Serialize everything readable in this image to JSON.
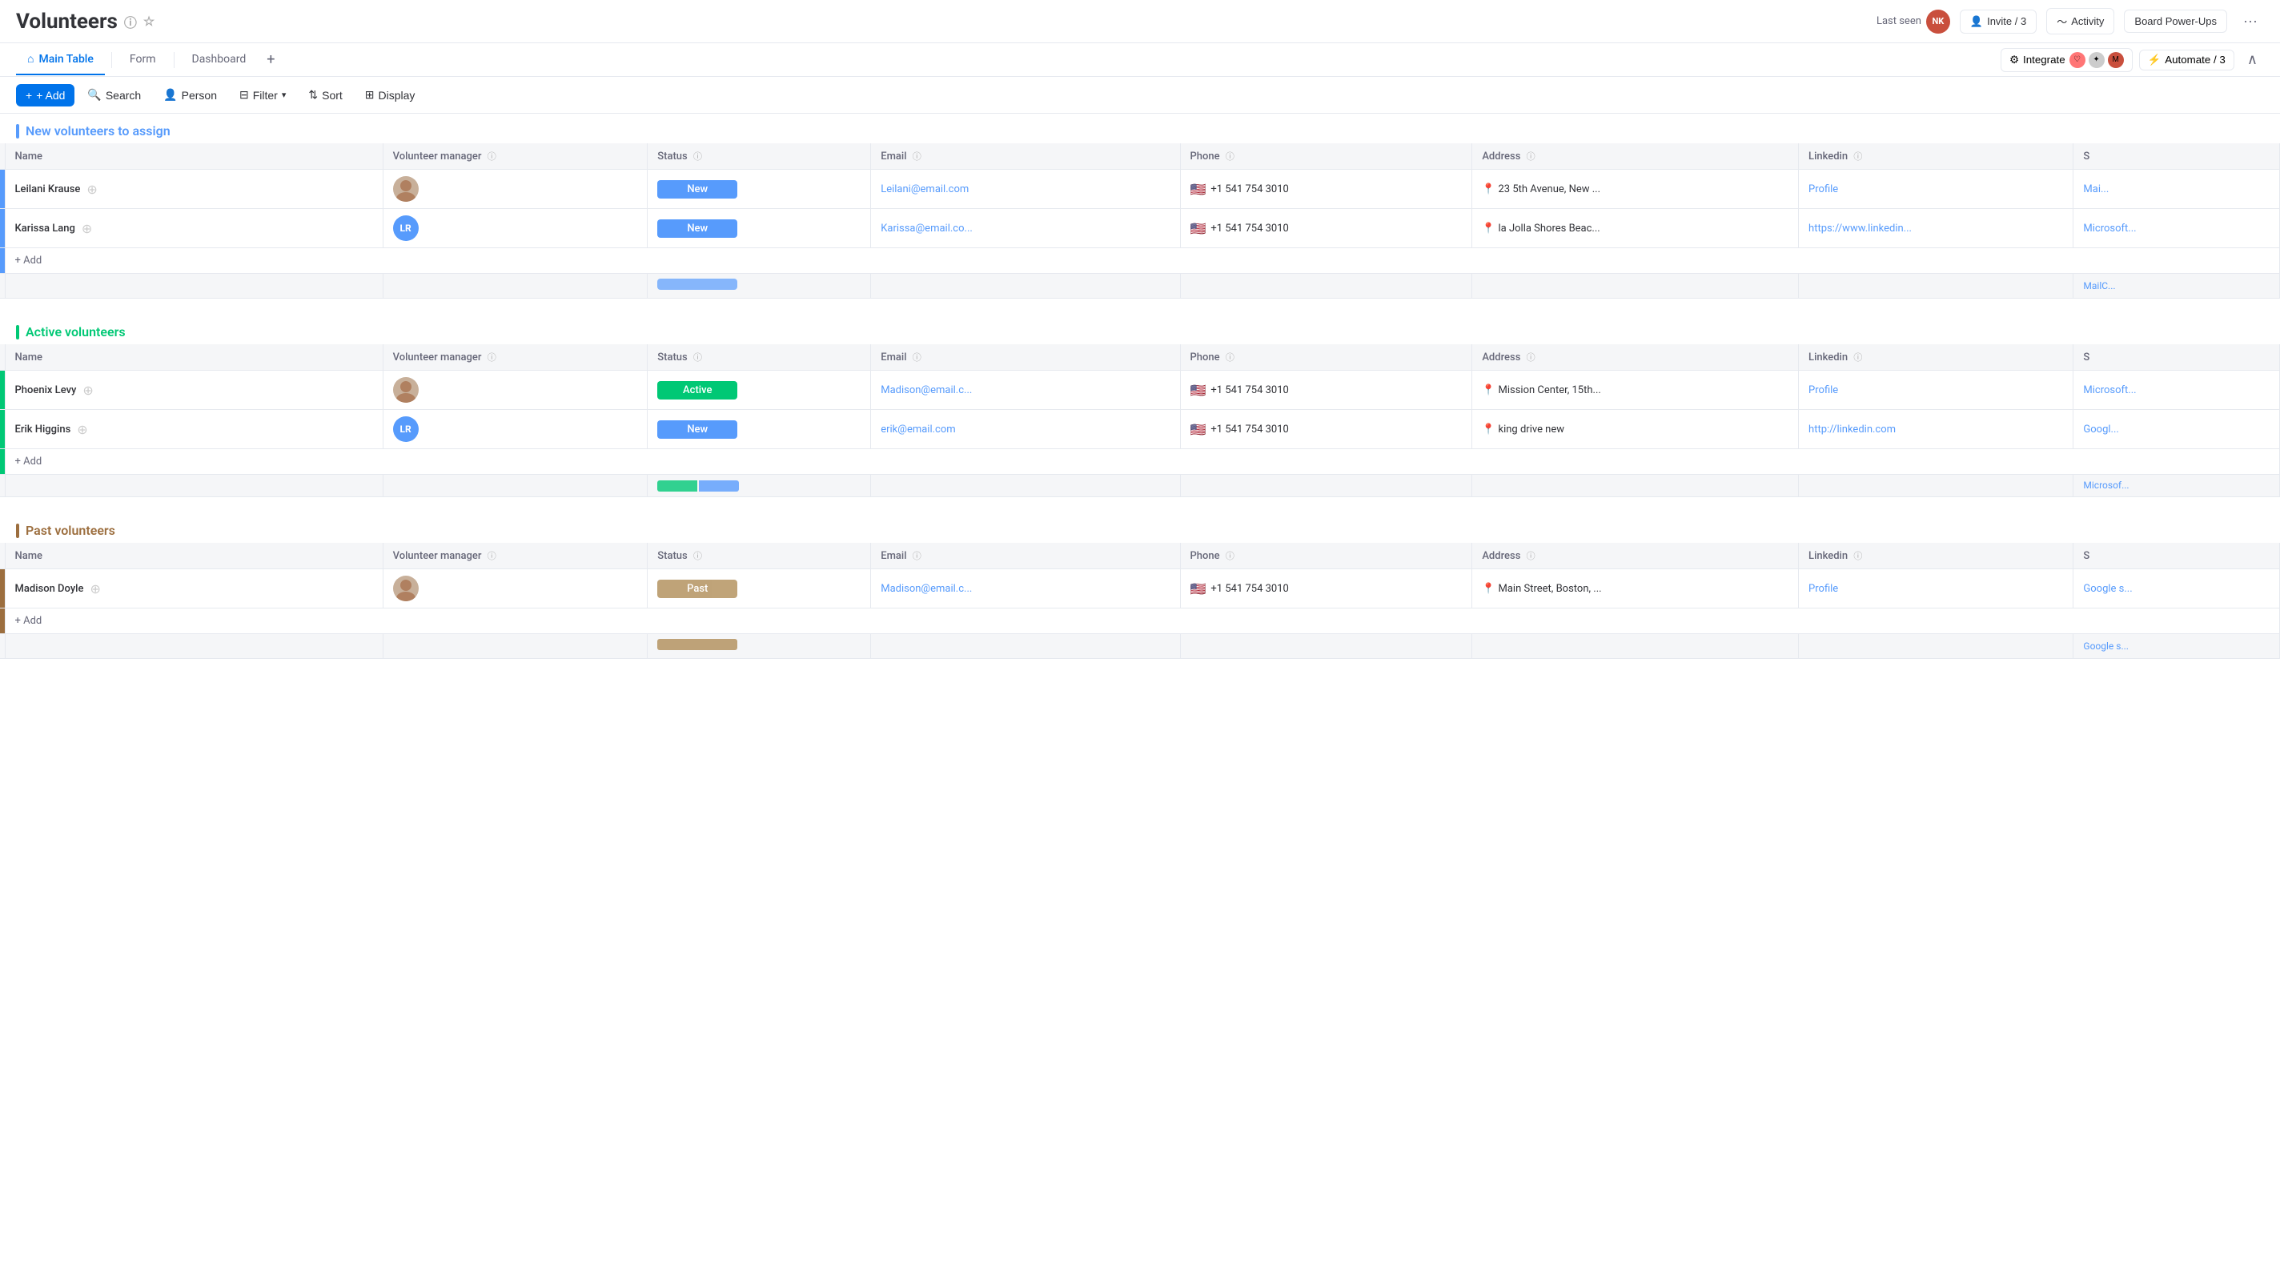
{
  "app": {
    "title": "Volunteers",
    "last_seen_label": "Last seen",
    "invite_label": "Invite / 3",
    "activity_label": "Activity",
    "board_powerups_label": "Board Power-Ups",
    "integrate_label": "Integrate",
    "automate_label": "Automate / 3"
  },
  "tabs": [
    {
      "id": "main-table",
      "label": "Main Table",
      "icon": "⌂",
      "active": true
    },
    {
      "id": "form",
      "label": "Form",
      "icon": "",
      "active": false
    },
    {
      "id": "dashboard",
      "label": "Dashboard",
      "icon": "",
      "active": false
    }
  ],
  "toolbar": {
    "add_label": "+ Add",
    "search_label": "Search",
    "person_label": "Person",
    "filter_label": "Filter",
    "sort_label": "Sort",
    "display_label": "Display"
  },
  "columns": {
    "name": "Name",
    "volunteer_manager": "Volunteer manager",
    "status": "Status",
    "email": "Email",
    "phone": "Phone",
    "address": "Address",
    "linkedin": "Linkedin",
    "s": "S"
  },
  "groups": [
    {
      "id": "new-volunteers",
      "title": "New volunteers to assign",
      "color": "blue",
      "rows": [
        {
          "name": "Leilani Krause",
          "manager_type": "photo",
          "manager_initials": "",
          "status": "New",
          "status_class": "status-new",
          "email": "Leilani@email.com",
          "phone": "+1 541 754 3010",
          "address": "23 5th Avenue, New ...",
          "linkedin": "Profile",
          "s": "Mai..."
        },
        {
          "name": "Karissa Lang",
          "manager_type": "initials",
          "manager_initials": "LR",
          "status": "New",
          "status_class": "status-new",
          "email": "Karissa@email.co...",
          "phone": "+1 541 754 3010",
          "address": "la Jolla Shores Beac...",
          "linkedin": "https://www.linkedin...",
          "s": "Microsoft..."
        }
      ],
      "summary_status_class": "status-new",
      "summary_s": "MailC..."
    },
    {
      "id": "active-volunteers",
      "title": "Active volunteers",
      "color": "green",
      "rows": [
        {
          "name": "Phoenix Levy",
          "manager_type": "photo",
          "manager_initials": "",
          "status": "Active",
          "status_class": "status-active",
          "email": "Madison@email.c...",
          "phone": "+1 541 754 3010",
          "address": "Mission Center, 15th...",
          "linkedin": "Profile",
          "s": "Microsoft..."
        },
        {
          "name": "Erik Higgins",
          "manager_type": "initials",
          "manager_initials": "LR",
          "status": "New",
          "status_class": "status-new",
          "email": "erik@email.com",
          "phone": "+1 541 754 3010",
          "address": "king drive new",
          "linkedin": "http://linkedin.com",
          "s": "Googl..."
        }
      ],
      "summary_status_class": "status-active",
      "summary_has_split": true,
      "summary_s": "Microsof..."
    },
    {
      "id": "past-volunteers",
      "title": "Past volunteers",
      "color": "brown",
      "rows": [
        {
          "name": "Madison Doyle",
          "manager_type": "photo",
          "manager_initials": "",
          "status": "Past",
          "status_class": "status-past",
          "email": "Madison@email.c...",
          "phone": "+1 541 754 3010",
          "address": "Main Street, Boston, ...",
          "linkedin": "Profile",
          "s": "Google s..."
        }
      ],
      "summary_status_class": "status-past",
      "summary_s": "Google s..."
    }
  ],
  "user_avatar": "NK",
  "colors": {
    "blue": "#579bfc",
    "green": "#00c875",
    "brown": "#9c6e3e",
    "purple": "#a25ddc"
  }
}
